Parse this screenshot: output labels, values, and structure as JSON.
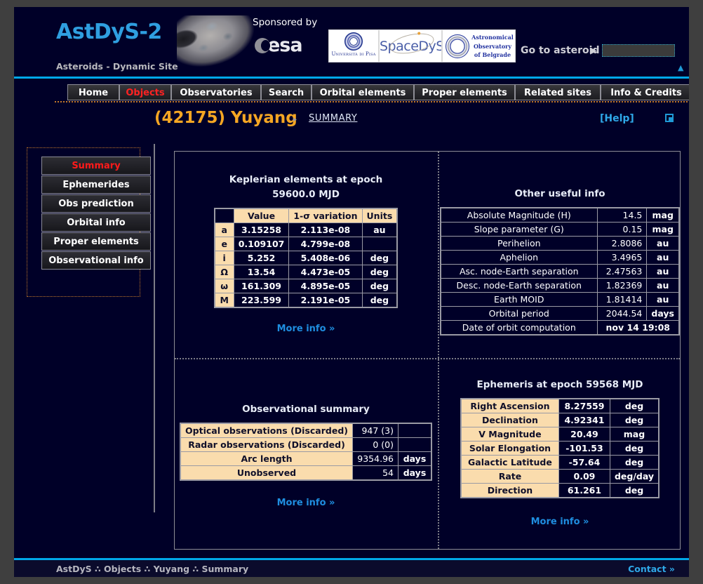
{
  "header": {
    "brand": "AstDyS-2",
    "subbrand": "Asteroids - Dynamic Site",
    "sponsored_label": "Sponsored by",
    "esa_label": "esa",
    "logos": [
      {
        "name": "unipi",
        "text": "Università di Pisa"
      },
      {
        "name": "spacedys",
        "text": "SpaceDyS"
      },
      {
        "name": "belgrade",
        "text": "Astronomical Observatory of Belgrade"
      }
    ],
    "goto_label": "Go to asteroid",
    "goto_arrow": "▶",
    "goto_value": "",
    "goto_placeholder": "",
    "scroll_top_arrow": "▲"
  },
  "tabs": [
    {
      "label": "Home",
      "active": false
    },
    {
      "label": "Objects",
      "active": true
    },
    {
      "label": "Observatories",
      "active": false
    },
    {
      "label": "Search",
      "active": false
    },
    {
      "label": "Orbital elements",
      "active": false
    },
    {
      "label": "Proper elements",
      "active": false
    },
    {
      "label": "Related sites",
      "active": false
    },
    {
      "label": "Info & Credits",
      "active": false
    }
  ],
  "title_row": {
    "object_title": "(42175) Yuyang",
    "separator": "▸",
    "section_link": "SUMMARY",
    "help_label": "[Help]",
    "print_icon": "print-icon"
  },
  "sidebar": {
    "items": [
      {
        "label": "Summary",
        "active": true
      },
      {
        "label": "Ephemerides",
        "active": false
      },
      {
        "label": "Obs prediction",
        "active": false
      },
      {
        "label": "Orbital info",
        "active": false
      },
      {
        "label": "Proper elements",
        "active": false
      },
      {
        "label": "Observational info",
        "active": false
      }
    ]
  },
  "keplerian": {
    "title_line1": "Keplerian elements at epoch",
    "title_line2": "59600.0 MJD",
    "headers": [
      "",
      "Value",
      "1-σ variation",
      "Units"
    ],
    "rows": [
      {
        "symbol": "a",
        "value": "3.15258",
        "variation": "2.113e-08",
        "units": "au"
      },
      {
        "symbol": "e",
        "value": "0.109107",
        "variation": "4.799e-08",
        "units": ""
      },
      {
        "symbol": "i",
        "value": "5.252",
        "variation": "5.408e-06",
        "units": "deg"
      },
      {
        "symbol": "Ω",
        "value": "13.54",
        "variation": "4.473e-05",
        "units": "deg"
      },
      {
        "symbol": "ω",
        "value": "161.309",
        "variation": "4.895e-05",
        "units": "deg"
      },
      {
        "symbol": "M",
        "value": "223.599",
        "variation": "2.191e-05",
        "units": "deg"
      }
    ],
    "more_info": "More info »"
  },
  "other_info": {
    "title": "Other useful info",
    "rows": [
      {
        "label": "Absolute Magnitude (H)",
        "value": "14.5",
        "units": "mag"
      },
      {
        "label": "Slope parameter (G)",
        "value": "0.15",
        "units": "mag"
      },
      {
        "label": "Perihelion",
        "value": "2.8086",
        "units": "au"
      },
      {
        "label": "Aphelion",
        "value": "3.4965",
        "units": "au"
      },
      {
        "label": "Asc. node-Earth separation",
        "value": "2.47563",
        "units": "au"
      },
      {
        "label": "Desc. node-Earth separation",
        "value": "1.82369",
        "units": "au"
      },
      {
        "label": "Earth MOID",
        "value": "1.81414",
        "units": "au"
      },
      {
        "label": "Orbital period",
        "value": "2044.54",
        "units": "days"
      },
      {
        "label": "Date of orbit computation",
        "value": "nov 14 19:08",
        "units": ""
      }
    ]
  },
  "observational": {
    "title": "Observational summary",
    "rows": [
      {
        "label": "Optical observations (Discarded)",
        "value": "947 (3)",
        "units": ""
      },
      {
        "label": "Radar observations (Discarded)",
        "value": "0 (0)",
        "units": ""
      },
      {
        "label": "Arc length",
        "value": "9354.96",
        "units": "days"
      },
      {
        "label": "Unobserved",
        "value": "54",
        "units": "days"
      }
    ],
    "more_info": "More info »"
  },
  "ephemeris": {
    "title": "Ephemeris at epoch 59568 MJD",
    "rows": [
      {
        "label": "Right Ascension",
        "value": "8.27559",
        "units": "deg"
      },
      {
        "label": "Declination",
        "value": "4.92341",
        "units": "deg"
      },
      {
        "label": "V Magnitude",
        "value": "20.49",
        "units": "mag"
      },
      {
        "label": "Solar Elongation",
        "value": "-101.53",
        "units": "deg"
      },
      {
        "label": "Galactic Latitude",
        "value": "-57.64",
        "units": "deg"
      },
      {
        "label": "Rate",
        "value": "0.09",
        "units": "deg/day"
      },
      {
        "label": "Direction",
        "value": "61.261",
        "units": "deg"
      }
    ],
    "more_info": "More info »"
  },
  "footer": {
    "path": "AstDyS ∴ Objects ∴ Yuyang ∴ Summary",
    "contact": "Contact »"
  },
  "colors": {
    "page_bg": "#000028",
    "outer_bg": "#3f3f3f",
    "accent_cyan": "#00a8e8",
    "accent_orange": "#f5a623",
    "active_red": "#ff1a1a",
    "tan": "#fadcad",
    "link_blue": "#1f8ee0"
  }
}
